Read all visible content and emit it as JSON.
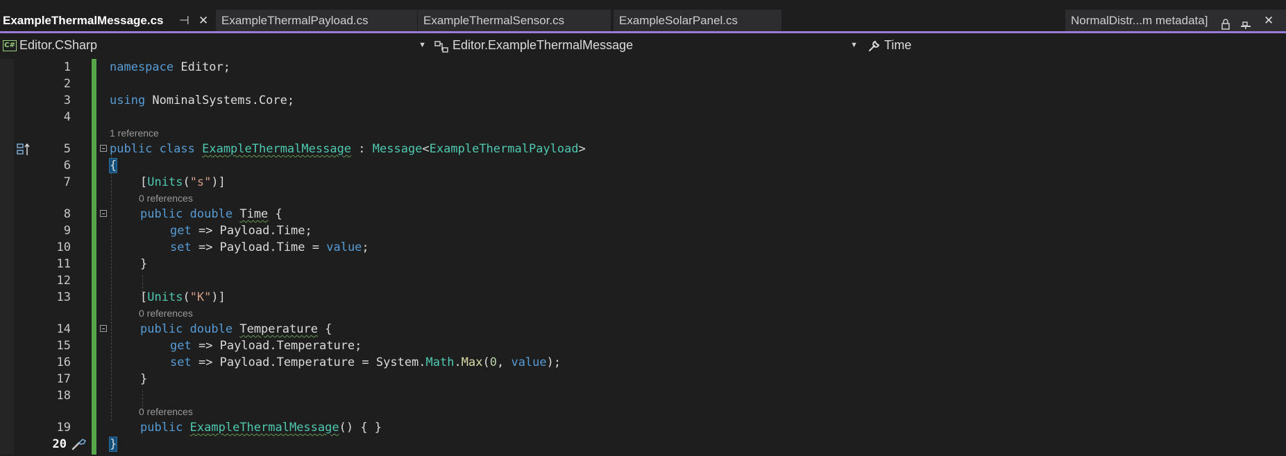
{
  "tabs": [
    {
      "label": "ExampleThermalMessage.cs",
      "active": true,
      "pin": "⊣",
      "close": "✕"
    },
    {
      "label": "ExampleThermalPayload.cs",
      "active": false
    },
    {
      "label": "ExampleThermalSensor.cs",
      "active": false
    },
    {
      "label": "ExampleSolarPanel.cs",
      "active": false
    },
    {
      "label": "NormalDistr...m metadata]",
      "active": false,
      "close": "✕"
    }
  ],
  "navbar": {
    "project_badge": "C#",
    "project": "Editor.CSharp",
    "type": "Editor.ExampleThermalMessage",
    "member": "Time"
  },
  "code_lens": {
    "one_reference": "1 reference",
    "zero_references": "0 references"
  },
  "lines": {
    "n1": "1",
    "n2": "2",
    "n3": "3",
    "n4": "4",
    "n5": "5",
    "n6": "6",
    "n7": "7",
    "n8": "8",
    "n9": "9",
    "n10": "10",
    "n11": "11",
    "n12": "12",
    "n13": "13",
    "n14": "14",
    "n15": "15",
    "n16": "16",
    "n17": "17",
    "n18": "18",
    "n19": "19",
    "n20": "20"
  },
  "code": {
    "kw_namespace": "namespace",
    "ns_name": " Editor;",
    "kw_using": "using",
    "using_target": " NominalSystems.Core;",
    "kw_public": "public",
    "kw_class": "class",
    "class_name": "ExampleThermalMessage",
    "colon": " : ",
    "base_type": "Message",
    "lt": "<",
    "payload_type": "ExampleThermalPayload",
    "gt": ">",
    "open_brace": "{",
    "close_brace": "}",
    "attr_open": "[",
    "units": "Units",
    "paren_open": "(",
    "str_s": "\"s\"",
    "str_k": "\"K\"",
    "attr_close": ")]",
    "kw_double": "double",
    "prop_time": "Time",
    "prop_temperature": "Temperature",
    "brace_space": " {",
    "kw_get": "get",
    "kw_set": "set",
    "arrow": " => ",
    "payload": "Payload",
    "dot": ".",
    "time_end": "Time;",
    "time_assign": "Time = ",
    "temp_end": "Temperature;",
    "temp_assign": "Temperature = ",
    "system": "System",
    "math": "Math",
    "max": "Max",
    "zero": "0",
    "comma": ", ",
    "kw_value": "value",
    "semi_end": ";",
    "paren_semi": ");",
    "ctor_tail": "() { }"
  }
}
